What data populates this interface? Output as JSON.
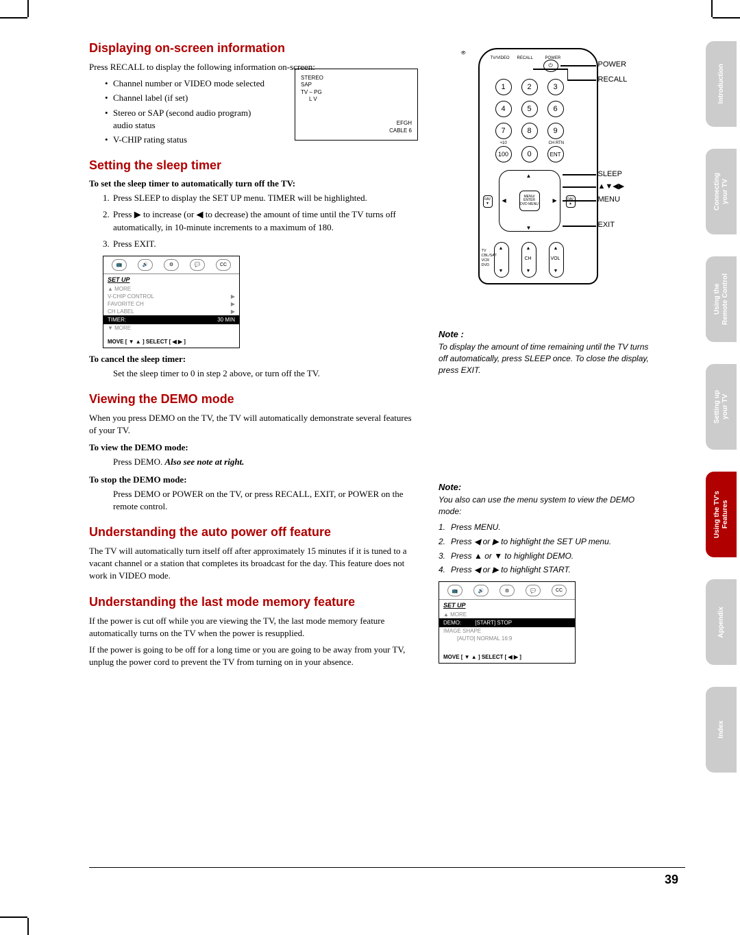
{
  "sections": {
    "displaying": {
      "title": "Displaying on-screen information",
      "intro": "Press RECALL to display the following information on-screen:",
      "bullets": [
        "Channel number or VIDEO mode selected",
        "Channel label (if set)",
        "Stereo or SAP (second audio program) audio status",
        "V-CHIP rating status"
      ],
      "osd": {
        "line1": "STEREO",
        "line2": "SAP",
        "line3": "TV – PG",
        "line4": "L    V",
        "right1": "EFGH",
        "right2": "CABLE       6"
      }
    },
    "sleep": {
      "title": "Setting the sleep timer",
      "sub1": "To set the sleep timer to automatically turn off the TV:",
      "steps": [
        "Press SLEEP to display the SET UP menu. TIMER will be highlighted.",
        "Press ▶ to increase (or ◀ to decrease) the amount of time until the TV turns off automatically, in 10-minute increments to a maximum of 180.",
        "Press EXIT."
      ],
      "menu": {
        "title": "SET UP",
        "items": [
          {
            "label": "▲ MORE",
            "value": ""
          },
          {
            "label": "V-CHIP CONTROL",
            "value": "▶"
          },
          {
            "label": "FAVORITE CH",
            "value": "▶"
          },
          {
            "label": "CH LABEL",
            "value": "▶"
          },
          {
            "label": "TIMER:",
            "value": "30 MIN",
            "highlight": true
          },
          {
            "label": "▼ MORE",
            "value": ""
          }
        ],
        "footer": "MOVE [ ▼ ▲ ]      SELECT [ ◀  ▶ ]"
      },
      "sub2": "To cancel the sleep timer:",
      "cancel_text": "Set the sleep timer to 0 in step 2 above, or turn off the TV."
    },
    "demo": {
      "title": "Viewing the DEMO mode",
      "intro": "When you press DEMO on the TV, the TV will automatically demonstrate several features of your TV.",
      "sub1": "To view the DEMO mode:",
      "view_text": "Press DEMO. ",
      "view_em": "Also see note at right.",
      "sub2": "To stop the DEMO mode:",
      "stop_text": "Press DEMO or POWER on the TV, or press RECALL, EXIT, or POWER on the remote control."
    },
    "autopower": {
      "title": "Understanding the auto power off feature",
      "text": "The TV will automatically turn itself off after approximately 15 minutes if it is tuned to a vacant channel or a station that completes its broadcast for the day. This feature does not work in VIDEO mode."
    },
    "lastmode": {
      "title": "Understanding the last mode memory feature",
      "p1": "If the power is cut off while you are viewing the TV, the last mode memory feature automatically turns on the TV when the power is resupplied.",
      "p2": "If the power is going to be off for a long time or you are going to be away from your TV, unplug the power cord to prevent the TV from turning on in your absence."
    }
  },
  "remote": {
    "labels": {
      "power": "POWER",
      "recall": "RECALL",
      "sleep": "SLEEP",
      "arrows": "▲▼◀▶",
      "menu": "MENU",
      "exit": "EXIT"
    },
    "top_row": {
      "tv": "TV/VIDEO",
      "rec": "RECALL",
      "pwr": "POWER"
    },
    "nums": [
      "1",
      "2",
      "3",
      "4",
      "5",
      "6",
      "7",
      "8",
      "9",
      "100",
      "0",
      "ENT"
    ],
    "under": {
      "plus10": "+10",
      "chrtn": "CH RTN"
    },
    "dpad_center": "MENU/\nENTER\nDVD MENU",
    "pills": {
      "left_labels": "TV\nCBL/SAT\nVCR\nDVD",
      "ch": "CH",
      "vol": "VOL"
    },
    "fav": "FAV"
  },
  "note_sleep": {
    "label": "Note :",
    "text": "To display the amount of time remaining until the TV turns off automatically, press SLEEP once. To close the display, press EXIT."
  },
  "note_demo": {
    "label": "Note:",
    "intro": "You also can use the menu system to view the DEMO mode:",
    "steps": [
      "Press MENU.",
      "Press ◀ or ▶ to highlight the SET UP menu.",
      "Press ▲ or ▼ to highlight DEMO.",
      "Press ◀ or ▶ to highlight START."
    ],
    "menu": {
      "title": "SET UP",
      "items": [
        {
          "label": "▲ MORE",
          "value": ""
        },
        {
          "label": "DEMO:",
          "value": "[START] STOP",
          "highlight": true
        },
        {
          "label": "IMAGE SHAPE",
          "value": ""
        },
        {
          "label": "",
          "value": "[AUTO] NORMAL 16:9"
        }
      ],
      "footer": "MOVE [ ▼ ▲ ]      SELECT [ ◀  ▶ ]"
    }
  },
  "side_tabs": [
    {
      "text": "Introduction",
      "active": false
    },
    {
      "text": "Connecting\nyour TV",
      "active": false
    },
    {
      "text": "Using the\nRemote Control",
      "active": false
    },
    {
      "text": "Setting up\nyour TV",
      "active": false
    },
    {
      "text": "Using the TV's\nFeatures",
      "active": true
    },
    {
      "text": "Appendix",
      "active": false
    },
    {
      "text": "Index",
      "active": false
    }
  ],
  "page_num": "39",
  "menu_tabs": [
    "📺",
    "🔊",
    "⚙",
    "💬",
    "CC"
  ]
}
